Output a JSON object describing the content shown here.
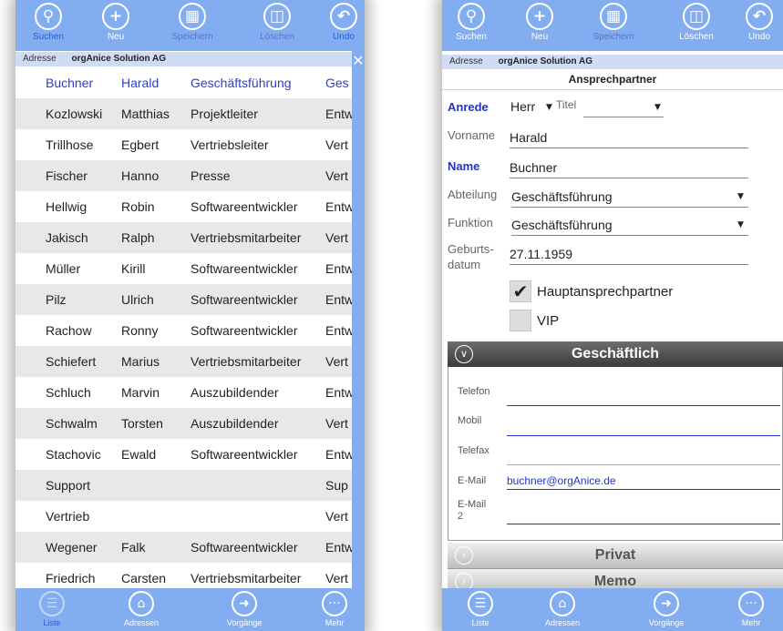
{
  "toolbar": {
    "search": "Suchen",
    "new": "Neu",
    "save": "Speichern",
    "delete": "Löschen",
    "undo": "Undo"
  },
  "address_bar": {
    "label": "Adresse",
    "value": "orgAnice Solution AG"
  },
  "list": {
    "header": [
      "Buchner",
      "Harald",
      "Geschäftsführung",
      "Ges"
    ],
    "rows": [
      [
        "Kozlowski",
        "Matthias",
        "Projektleiter",
        "Entw"
      ],
      [
        "Trillhose",
        "Egbert",
        "Vertriebsleiter",
        "Vert"
      ],
      [
        "Fischer",
        "Hanno",
        "Presse",
        "Vert"
      ],
      [
        "Hellwig",
        "Robin",
        "Softwareentwickler",
        "Entw"
      ],
      [
        "Jakisch",
        "Ralph",
        "Vertriebsmitarbeiter",
        "Vert"
      ],
      [
        "Müller",
        "Kirill",
        "Softwareentwickler",
        "Entw"
      ],
      [
        "Pilz",
        "Ulrich",
        "Softwareentwickler",
        "Entw"
      ],
      [
        "Rachow",
        "Ronny",
        "Softwareentwickler",
        "Entw"
      ],
      [
        "Schiefert",
        "Marius",
        "Vertriebsmitarbeiter",
        "Vert"
      ],
      [
        "Schluch",
        "Marvin",
        "Auszubildender",
        "Entw"
      ],
      [
        "Schwalm",
        "Torsten",
        "Auszubildender",
        "Vert"
      ],
      [
        "Stachovic",
        "Ewald",
        "Softwareentwickler",
        "Entw"
      ],
      [
        "Support",
        "",
        "",
        "Sup"
      ],
      [
        "Vertrieb",
        "",
        "",
        "Vert"
      ],
      [
        "Wegener",
        "Falk",
        "Softwareentwickler",
        "Entw"
      ],
      [
        "Friedrich",
        "Carsten",
        "Vertriebsmitarbeiter",
        "Vert"
      ]
    ]
  },
  "bottom_nav": {
    "list": "Liste",
    "addresses": "Adressen",
    "processes": "Vorgänge",
    "more": "Mehr"
  },
  "form": {
    "title": "Ansprechpartner",
    "salutation_label": "Anrede",
    "salutation_value": "Herr",
    "title_label": "Titel",
    "title_value": "",
    "firstname_label": "Vorname",
    "firstname_value": "Harald",
    "name_label": "Name",
    "name_value": "Buchner",
    "department_label": "Abteilung",
    "department_value": "Geschäftsführung",
    "function_label": "Funktion",
    "function_value": "Geschäftsführung",
    "birth_label_1": "Geburts-",
    "birth_label_2": "datum",
    "birth_value": "27.11.1959",
    "main_contact_label": "Hauptansprechpartner",
    "main_contact_checked": true,
    "vip_label": "VIP",
    "vip_checked": false
  },
  "sections": {
    "business": "Geschäftlich",
    "private": "Privat",
    "memo": "Memo"
  },
  "contact": {
    "phone_label": "Telefon",
    "phone_value": "",
    "mobile_label": "Mobil",
    "mobile_value": "",
    "fax_label": "Telefax",
    "fax_value": "",
    "email_label": "E-Mail",
    "email_value": "buchner@orgAnice.de",
    "email2_label_1": "E-Mail",
    "email2_label_2": "2",
    "email2_value": ""
  },
  "icons": {
    "search": "search-icon",
    "new": "plus-icon",
    "save": "save-icon",
    "delete": "trash-icon",
    "undo": "undo-icon",
    "list": "list-icon",
    "addresses": "house-icon",
    "processes": "arrow-right-icon",
    "more": "more-dots-icon"
  },
  "colors": {
    "accent": "#82adf1",
    "required_label": "#2531c9",
    "link": "#2233cc"
  }
}
